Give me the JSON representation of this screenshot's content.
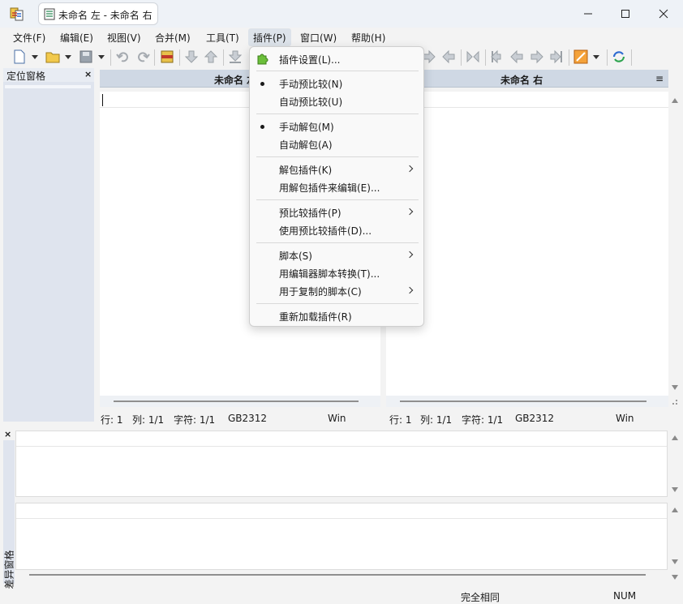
{
  "window": {
    "tab_title": "未命名 左 - 未命名 右"
  },
  "menubar": {
    "items": [
      "文件(F)",
      "编辑(E)",
      "视图(V)",
      "合并(M)",
      "工具(T)",
      "插件(P)",
      "窗口(W)",
      "帮助(H)"
    ],
    "active": "插件(P)"
  },
  "location_pane": {
    "title": "定位窗格"
  },
  "left_pane": {
    "title": "未命名 左",
    "status": {
      "line": "行: 1",
      "col": "列: 1/1",
      "chars": "字符: 1/1",
      "encoding": "GB2312",
      "eol": "Win"
    }
  },
  "right_pane": {
    "title": "未命名 右",
    "menu_glyph": "≡",
    "status": {
      "line": "行: 1",
      "col": "列: 1/1",
      "chars": "字符: 1/1",
      "encoding": "GB2312",
      "eol": "Win"
    }
  },
  "diff_pane": {
    "title": "差异窗格"
  },
  "statusbar": {
    "result": "完全相同",
    "num": "NUM"
  },
  "plugin_menu": {
    "items": [
      {
        "label": "插件设置(L)...",
        "has_icon": true
      },
      {
        "label": "手动预比较(N)",
        "checked": true
      },
      {
        "label": "自动预比较(U)"
      },
      {
        "label": "手动解包(M)",
        "checked": true
      },
      {
        "label": "自动解包(A)"
      },
      {
        "label": "解包插件(K)",
        "submenu": true
      },
      {
        "label": "用解包插件来编辑(E)..."
      },
      {
        "label": "预比较插件(P)",
        "submenu": true
      },
      {
        "label": "使用预比较插件(D)..."
      },
      {
        "label": "脚本(S)",
        "submenu": true
      },
      {
        "label": "用编辑器脚本转换(T)..."
      },
      {
        "label": "用于复制的脚本(C)",
        "submenu": true
      },
      {
        "label": "重新加载插件(R)"
      }
    ]
  },
  "icons": [
    "app-icon",
    "document-icon",
    "minimize-icon",
    "maximize-icon",
    "close-icon",
    "new-file-icon",
    "open-folder-icon",
    "save-icon",
    "undo-icon",
    "redo-icon",
    "plugin-icon"
  ],
  "colors": {
    "pane_header": "#cfd8e4",
    "side_pane": "#dfe4ee",
    "menu_bg": "#f9f9f9"
  }
}
